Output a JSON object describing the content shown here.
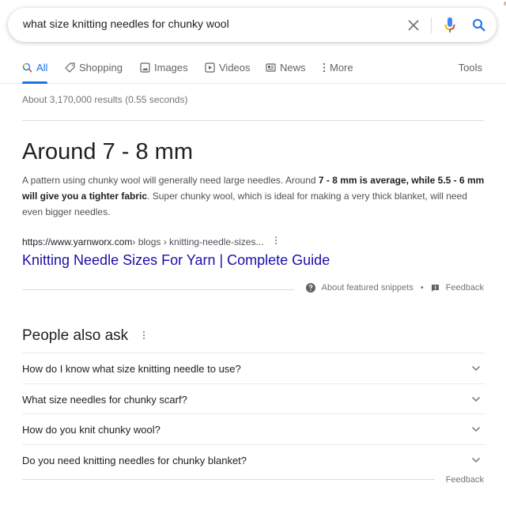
{
  "search": {
    "query": "what size knitting needles for chunky wool",
    "clear_icon": "close-icon",
    "mic_icon": "microphone-icon",
    "search_icon": "search-icon"
  },
  "tabs": [
    {
      "label": "All",
      "icon": "search-icon",
      "active": true
    },
    {
      "label": "Shopping",
      "icon": "tag-icon"
    },
    {
      "label": "Images",
      "icon": "image-icon"
    },
    {
      "label": "Videos",
      "icon": "play-icon"
    },
    {
      "label": "News",
      "icon": "newspaper-icon"
    },
    {
      "label": "More",
      "icon": "more-vert-icon"
    }
  ],
  "tools_label": "Tools",
  "stats": "About 3,170,000 results (0.55 seconds)",
  "featured_snippet": {
    "answer": "Around 7 - 8 mm",
    "text_parts": [
      {
        "text": "A pattern using chunky wool will generally need large needles. Around ",
        "bold": false
      },
      {
        "text": "7 - 8 mm is average, while 5.5 - 6 mm will give you a tighter fabric",
        "bold": true
      },
      {
        "text": ". Super chunky wool, which is ideal for making a very thick blanket, will need even bigger needles.",
        "bold": false
      }
    ],
    "cite_domain": "https://www.yarnworx.com",
    "cite_path": " › blogs › knitting-needle-sizes...",
    "title": "Knitting Needle Sizes For Yarn | Complete Guide",
    "about_label": "About featured snippets",
    "separator": "•",
    "feedback_label": "Feedback"
  },
  "people_also_ask": {
    "title": "People also ask",
    "questions": [
      "How do I know what size knitting needle to use?",
      "What size needles for chunky scarf?",
      "How do you knit chunky wool?",
      "Do you need knitting needles for chunky blanket?"
    ],
    "feedback_label": "Feedback"
  },
  "colors": {
    "accent": "#1a73e8",
    "link": "#1a0dab",
    "muted": "#70757a"
  }
}
